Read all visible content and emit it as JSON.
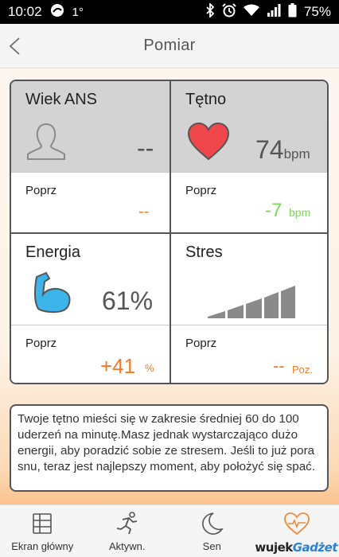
{
  "status_bar": {
    "time": "10:02",
    "temperature": "1°",
    "battery": "75%"
  },
  "header": {
    "title": "Pomiar",
    "back_label": "<"
  },
  "metrics": {
    "ans_age": {
      "label": "Wiek ANS",
      "value": "--",
      "prev_label": "Poprz",
      "prev_value": "--",
      "prev_color": "#f07c2c"
    },
    "heart_rate": {
      "label": "Tętno",
      "value": "74",
      "unit": "bpm",
      "prev_label": "Poprz",
      "prev_value": "-7",
      "prev_unit": "bpm",
      "prev_color": "#7fd65a"
    },
    "energy": {
      "label": "Energia",
      "value": "61%",
      "prev_label": "Poprz",
      "prev_value": "+41",
      "prev_unit": "%",
      "prev_color": "#f07c2c"
    },
    "stress": {
      "label": "Stres",
      "level_fraction": 1.0,
      "prev_label": "Poprz",
      "prev_value": "--",
      "prev_unit": "Poz.",
      "prev_color": "#f07c2c"
    }
  },
  "advice": {
    "text": "Twoje tętno mieści się w zakresie średniej 60 do 100 uderzeń na minutę.Masz jednak wystarczająco dużo energii, aby poradzić sobie ze stresem. Jeśli to już pora snu, teraz jest najlepszy moment, aby położyć się spać."
  },
  "nav": {
    "items": [
      {
        "label": "Ekran główny",
        "icon": "home-grid-icon"
      },
      {
        "label": "Aktywn.",
        "icon": "running-person-icon"
      },
      {
        "label": "Sen",
        "icon": "moon-icon"
      },
      {
        "label": "",
        "icon": "heart-pulse-icon"
      }
    ]
  },
  "watermark": {
    "part1": "wujek",
    "part2": "Gadżet"
  },
  "colors": {
    "accent_orange": "#f07c2c",
    "positive_green": "#7fd65a",
    "heart_red": "#f0474b",
    "muscle_blue": "#3cb4ea"
  }
}
